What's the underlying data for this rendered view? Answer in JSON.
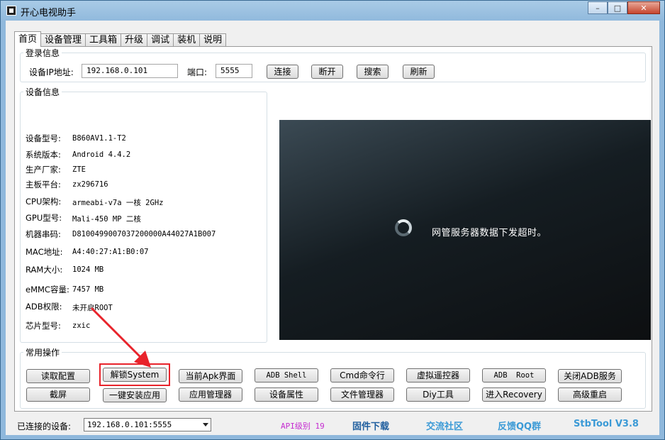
{
  "window": {
    "title": "开心电视助手",
    "controls": {
      "minimize": "–",
      "maximize": "□",
      "close": "✕"
    }
  },
  "tabs": [
    "首页",
    "设备管理",
    "工具箱",
    "升级",
    "调试",
    "装机",
    "说明"
  ],
  "login": {
    "legend": "登录信息",
    "ip_label": "设备IP地址:",
    "ip_value": "192.168.0.101",
    "port_label": "端口:",
    "port_value": "5555",
    "buttons": [
      "连接",
      "断开",
      "搜索",
      "刷新"
    ]
  },
  "device_info": {
    "legend": "设备信息",
    "rows": [
      {
        "label": "设备型号:",
        "value": "B860AV1.1-T2"
      },
      {
        "label": "系统版本:",
        "value": "Android 4.4.2"
      },
      {
        "label": "生产厂家:",
        "value": "ZTE"
      },
      {
        "label": "主板平台:",
        "value": "zx296716"
      },
      {
        "label": "CPU架构:",
        "value": "armeabi-v7a 一核 2GHz"
      },
      {
        "label": "GPU型号:",
        "value": "Mali-450 MP 二核"
      },
      {
        "label": "机器串码:",
        "value": "D8100499007037200000A44027A1B007"
      },
      {
        "label": "MAC地址:",
        "value": "A4:40:27:A1:B0:07"
      },
      {
        "label": "RAM大小:",
        "value": "1024 MB"
      },
      {
        "label": "eMMC容量:",
        "value": "7457 MB"
      },
      {
        "label": "ADB权限:",
        "value": "未开启ROOT"
      },
      {
        "label": "芯片型号:",
        "value": "zxic"
      }
    ]
  },
  "preview": {
    "message": "网管服务器数据下发超时。"
  },
  "common_ops": {
    "legend": "常用操作",
    "row1": [
      "读取配置",
      "解锁System",
      "当前Apk界面",
      "ADB Shell",
      "Cmd命令行",
      "虚拟遥控器",
      "ADB  Root",
      "关闭ADB服务"
    ],
    "row2": [
      "截屏",
      "一键安装应用",
      "应用管理器",
      "设备属性",
      "文件管理器",
      "Diy工具",
      "进入Recovery",
      "高级重启"
    ]
  },
  "status": {
    "connected_label": "已连接的设备:",
    "connected_value": "192.168.0.101:5555",
    "api_level": "API级别 19",
    "links": [
      "固件下载",
      "交流社区",
      "反馈QQ群",
      "StbTool V3.8"
    ]
  },
  "colors": {
    "api": "#c42ad0",
    "firmware": "#1f5e9e",
    "community": "#3b9ad6",
    "feedback": "#3b9ad6",
    "version": "#3b9ad6",
    "highlight": "#e8232b"
  }
}
